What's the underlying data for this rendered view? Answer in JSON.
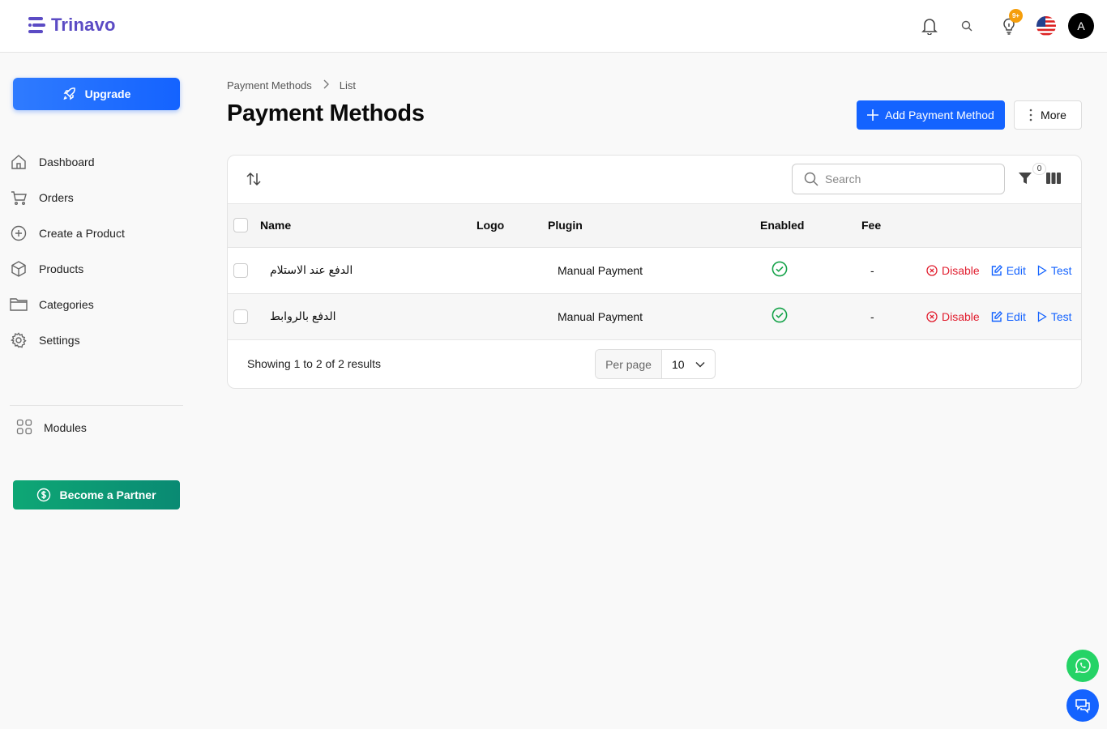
{
  "brand": {
    "name": "Trinavo",
    "color": "#5b4bc4"
  },
  "topbar": {
    "notifications_icon": "bell-icon",
    "search_icon": "search-icon",
    "tips_badge": "9+",
    "language_flag": "us-flag-icon",
    "avatar_initial": "A"
  },
  "sidebar": {
    "upgrade_label": "Upgrade",
    "items": [
      {
        "label": "Dashboard",
        "icon": "home-icon"
      },
      {
        "label": "Orders",
        "icon": "cart-icon"
      },
      {
        "label": "Create a Product",
        "icon": "plus-circle-icon"
      },
      {
        "label": "Products",
        "icon": "box-icon"
      },
      {
        "label": "Categories",
        "icon": "folder-icon"
      },
      {
        "label": "Settings",
        "icon": "gear-icon"
      }
    ],
    "modules_label": "Modules",
    "partner_label": "Become a Partner"
  },
  "breadcrumb": {
    "parent": "Payment Methods",
    "current": "List"
  },
  "page": {
    "title": "Payment Methods",
    "add_button": "Add Payment Method",
    "more_button": "More"
  },
  "table": {
    "search_placeholder": "Search",
    "filter_count": "0",
    "columns": [
      "Name",
      "Logo",
      "Plugin",
      "Enabled",
      "Fee"
    ],
    "rows": [
      {
        "name": "الدفع عند الاستلام",
        "logo": "",
        "plugin": "Manual Payment",
        "enabled": true,
        "fee": "-"
      },
      {
        "name": "الدفع بالروابط",
        "logo": "",
        "plugin": "Manual Payment",
        "enabled": true,
        "fee": "-"
      }
    ],
    "actions": {
      "disable": "Disable",
      "edit": "Edit",
      "test": "Test"
    },
    "results_text": "Showing 1 to 2 of 2 results",
    "per_page_label": "Per page",
    "per_page_value": "10"
  },
  "colors": {
    "primary": "#1463ff",
    "danger": "#e11d2e",
    "success": "#16a34a",
    "partner": "#0ea775"
  }
}
